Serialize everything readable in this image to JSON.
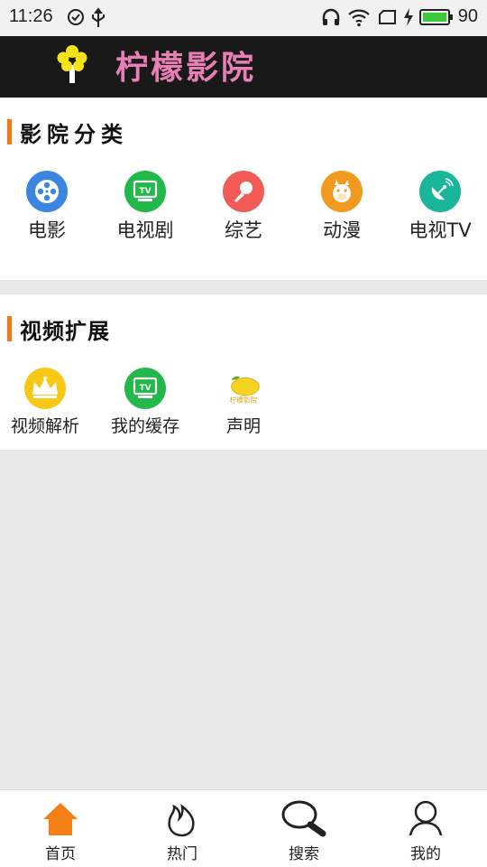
{
  "status_bar": {
    "time": "11:26",
    "battery": "90"
  },
  "header": {
    "logo_text": "柠檬影院"
  },
  "sections": {
    "cinema": {
      "title": "影院分类",
      "items": [
        {
          "label": "电影",
          "icon": "film-reel-icon",
          "color": "#3a86e0"
        },
        {
          "label": "电视剧",
          "icon": "tv-icon",
          "color": "#22b84a"
        },
        {
          "label": "综艺",
          "icon": "microphone-icon",
          "color": "#f15a55"
        },
        {
          "label": "动漫",
          "icon": "cartoon-cat-icon",
          "color": "#f29a1f"
        },
        {
          "label": "电视TV",
          "icon": "satellite-dish-icon",
          "color": "#19b69a"
        }
      ]
    },
    "extension": {
      "title": "视频扩展",
      "items": [
        {
          "label": "视频解析",
          "icon": "crown-icon",
          "color": "#f7c815"
        },
        {
          "label": "我的缓存",
          "icon": "tv-icon",
          "color": "#22b84a"
        },
        {
          "label": "声明",
          "icon": "lemon-logo-icon",
          "color": "#f5d320",
          "logo_caption": "柠檬影院"
        }
      ]
    }
  },
  "bottom_nav": [
    {
      "label": "首页",
      "icon": "home-icon",
      "active": true
    },
    {
      "label": "热门",
      "icon": "flame-icon",
      "active": false
    },
    {
      "label": "搜索",
      "icon": "search-icon",
      "active": false
    },
    {
      "label": "我的",
      "icon": "user-icon",
      "active": false
    }
  ],
  "colors": {
    "accent": "#f07c18",
    "header_bg": "#191919",
    "logo_pink": "#e97fb4"
  }
}
